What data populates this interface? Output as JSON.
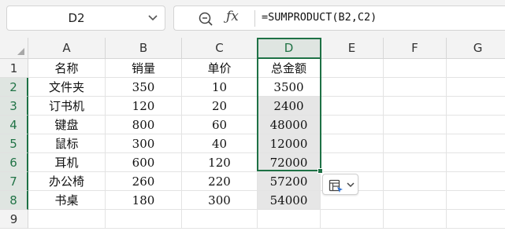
{
  "namebox": {
    "value": "D2"
  },
  "formula": {
    "text": "=SUMPRODUCT(B2,C2)"
  },
  "columns": [
    "A",
    "B",
    "C",
    "D",
    "E",
    "F",
    "G"
  ],
  "rows": [
    "1",
    "2",
    "3",
    "4",
    "5",
    "6",
    "7",
    "8",
    "9"
  ],
  "table": {
    "headers": [
      "名称",
      "销量",
      "单价",
      "总金额"
    ],
    "r2": [
      "文件夹",
      "350",
      "10",
      "3500"
    ],
    "r3": [
      "订书机",
      "120",
      "20",
      "2400"
    ],
    "r4": [
      "键盘",
      "800",
      "60",
      "48000"
    ],
    "r5": [
      "鼠标",
      "300",
      "40",
      "12000"
    ],
    "r6": [
      "耳机",
      "600",
      "120",
      "72000"
    ],
    "r7": [
      "办公椅",
      "260",
      "220",
      "57200"
    ],
    "r8": [
      "书桌",
      "180",
      "300",
      "54000"
    ]
  },
  "colors": {
    "accent": "#1e7145",
    "selection_fill": "#e6e6e6"
  },
  "icons": {
    "zoom": "zoom-out-icon",
    "fx": "fx-icon",
    "dropdown": "chevron-down-icon",
    "paste": "paste-options-icon"
  }
}
